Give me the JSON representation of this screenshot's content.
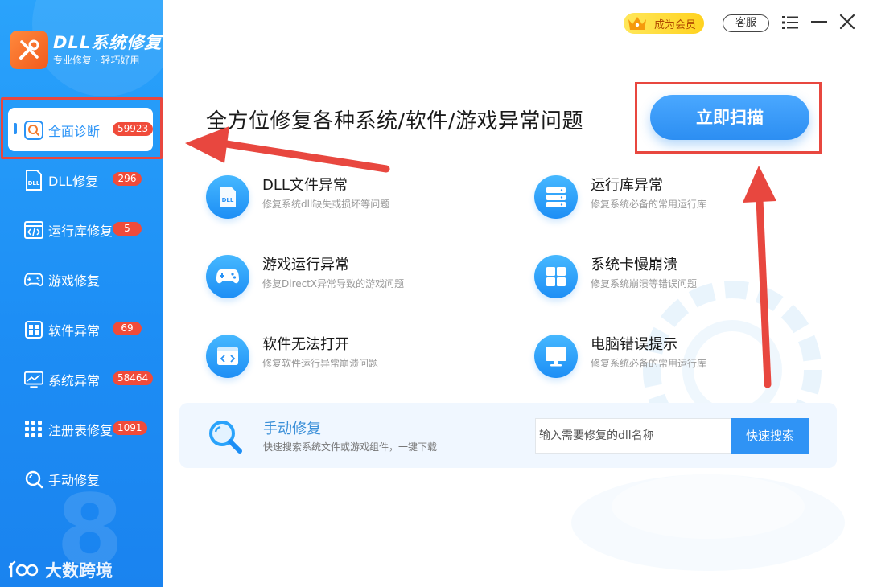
{
  "brand": {
    "title": "DLL系统修复",
    "subtitle": "专业修复 · 轻巧好用"
  },
  "sidebar": {
    "items": [
      {
        "label": "全面诊断",
        "badge": "59923",
        "icon": "search-icon"
      },
      {
        "label": "DLL修复",
        "badge": "296",
        "icon": "dll-icon"
      },
      {
        "label": "运行库修复",
        "badge": "5",
        "icon": "code-window-icon"
      },
      {
        "label": "游戏修复",
        "badge": "",
        "icon": "gamepad-icon"
      },
      {
        "label": "软件异常",
        "badge": "69",
        "icon": "grid-icon"
      },
      {
        "label": "系统异常",
        "badge": "58464",
        "icon": "monitor-chart-icon"
      },
      {
        "label": "注册表修复",
        "badge": "1091",
        "icon": "registry-grid-icon"
      },
      {
        "label": "手动修复",
        "badge": "",
        "icon": "magnifier-icon"
      }
    ]
  },
  "watermark": {
    "text": "大数跨境"
  },
  "header": {
    "vip_label": "成为会员",
    "service_label": "客服"
  },
  "main": {
    "headline": "全方位修复各种系统/软件/游戏异常问题",
    "scan_label": "立即扫描",
    "features": [
      {
        "title": "DLL文件异常",
        "desc": "修复系统dll缺失或损坏等问题",
        "icon": "dll-file-icon"
      },
      {
        "title": "运行库异常",
        "desc": "修复系统必备的常用运行库",
        "icon": "server-stack-icon"
      },
      {
        "title": "游戏运行异常",
        "desc": "修复DirectX异常导致的游戏问题",
        "icon": "gamepad-icon"
      },
      {
        "title": "系统卡慢崩溃",
        "desc": "修复系统崩溃等错误问题",
        "icon": "windows-icon"
      },
      {
        "title": "软件无法打开",
        "desc": "修复软件运行异常崩溃问题",
        "icon": "code-window-icon"
      },
      {
        "title": "电脑错误提示",
        "desc": "修复系统必备的常用运行库",
        "icon": "monitor-icon"
      }
    ],
    "manual": {
      "title": "手动修复",
      "desc": "快速搜索系统文件或游戏组件，一键下载",
      "placeholder": "输入需要修复的dll名称",
      "search_label": "快速搜索"
    }
  },
  "colors": {
    "accent": "#2f93f5",
    "badge": "#f04b3a",
    "highlight": "#e8473f",
    "vip": "#ffd21f"
  }
}
